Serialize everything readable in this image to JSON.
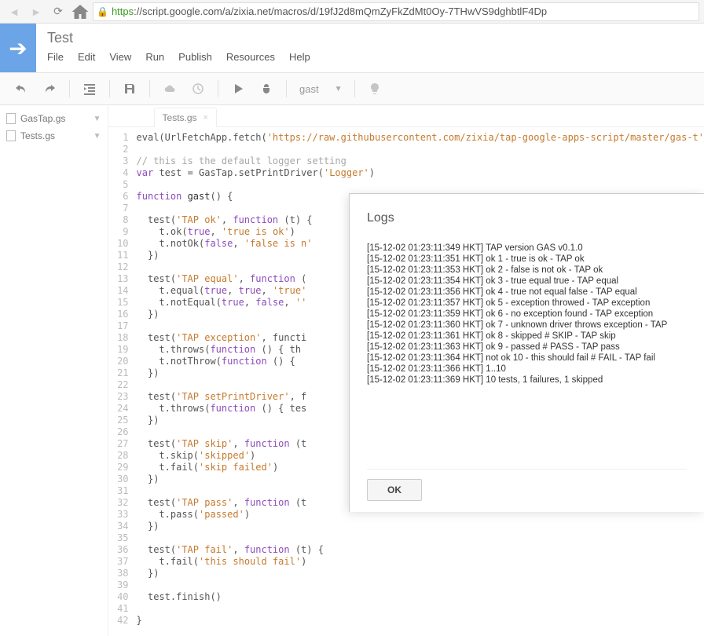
{
  "browser": {
    "url_https": "https",
    "url_rest": "://script.google.com/a/zixia.net/macros/d/19fJ2d8mQmZyFkZdMt0Oy-7THwVS9dghbtlF4Dp"
  },
  "app": {
    "title": "Test",
    "menus": [
      "File",
      "Edit",
      "View",
      "Run",
      "Publish",
      "Resources",
      "Help"
    ],
    "func_select": "gast"
  },
  "sidebar": {
    "files": [
      "GasTap.gs",
      "Tests.gs"
    ]
  },
  "tabs": {
    "active": "Tests.gs"
  },
  "code": {
    "lines": [
      {
        "n": 1,
        "html": "eval(UrlFetchApp.fetch(<span class='c-s'>'https://raw.githubusercontent.com/zixia/tap-google-apps-script/master/gas-t'</span>"
      },
      {
        "n": 2,
        "html": ""
      },
      {
        "n": 3,
        "html": "<span class='c-c'>// this is the default logger setting</span>"
      },
      {
        "n": 4,
        "html": "<span class='c-k'>var</span> test = GasTap.setPrintDriver(<span class='c-s'>'Logger'</span>)"
      },
      {
        "n": 5,
        "html": ""
      },
      {
        "n": 6,
        "html": "<span class='c-k'>function</span> <span class='c-f'>gast</span>() {"
      },
      {
        "n": 7,
        "html": ""
      },
      {
        "n": 8,
        "html": "  test(<span class='c-s'>'TAP ok'</span>, <span class='c-k'>function</span> (t) {"
      },
      {
        "n": 9,
        "html": "    t.ok(<span class='c-k'>true</span>, <span class='c-s'>'true is ok'</span>)"
      },
      {
        "n": 10,
        "html": "    t.notOk(<span class='c-k'>false</span>, <span class='c-s'>'false is n'</span>"
      },
      {
        "n": 11,
        "html": "  })"
      },
      {
        "n": 12,
        "html": ""
      },
      {
        "n": 13,
        "html": "  test(<span class='c-s'>'TAP equal'</span>, <span class='c-k'>function</span> ("
      },
      {
        "n": 14,
        "html": "    t.equal(<span class='c-k'>true</span>, <span class='c-k'>true</span>, <span class='c-s'>'true'</span>"
      },
      {
        "n": 15,
        "html": "    t.notEqual(<span class='c-k'>true</span>, <span class='c-k'>false</span>, <span class='c-s'>''</span>"
      },
      {
        "n": 16,
        "html": "  })"
      },
      {
        "n": 17,
        "html": ""
      },
      {
        "n": 18,
        "html": "  test(<span class='c-s'>'TAP exception'</span>, functi"
      },
      {
        "n": 19,
        "html": "    t.throws(<span class='c-k'>function</span> () { th"
      },
      {
        "n": 20,
        "html": "    t.notThrow(<span class='c-k'>function</span> () {"
      },
      {
        "n": 21,
        "html": "  })"
      },
      {
        "n": 22,
        "html": ""
      },
      {
        "n": 23,
        "html": "  test(<span class='c-s'>'TAP setPrintDriver'</span>, f"
      },
      {
        "n": 24,
        "html": "    t.throws(<span class='c-k'>function</span> () { tes"
      },
      {
        "n": 25,
        "html": "  })"
      },
      {
        "n": 26,
        "html": ""
      },
      {
        "n": 27,
        "html": "  test(<span class='c-s'>'TAP skip'</span>, <span class='c-k'>function</span> (t"
      },
      {
        "n": 28,
        "html": "    t.skip(<span class='c-s'>'skipped'</span>)"
      },
      {
        "n": 29,
        "html": "    t.fail(<span class='c-s'>'skip failed'</span>)"
      },
      {
        "n": 30,
        "html": "  })"
      },
      {
        "n": 31,
        "html": ""
      },
      {
        "n": 32,
        "html": "  test(<span class='c-s'>'TAP pass'</span>, <span class='c-k'>function</span> (t"
      },
      {
        "n": 33,
        "html": "    t.pass(<span class='c-s'>'passed'</span>)"
      },
      {
        "n": 34,
        "html": "  })"
      },
      {
        "n": 35,
        "html": ""
      },
      {
        "n": 36,
        "html": "  test(<span class='c-s'>'TAP fail'</span>, <span class='c-k'>function</span> (t) {"
      },
      {
        "n": 37,
        "html": "    t.fail(<span class='c-s'>'this should fail'</span>)"
      },
      {
        "n": 38,
        "html": "  })"
      },
      {
        "n": 39,
        "html": ""
      },
      {
        "n": 40,
        "html": "  test.finish()"
      },
      {
        "n": 41,
        "html": ""
      },
      {
        "n": 42,
        "html": "}"
      }
    ]
  },
  "dialog": {
    "title": "Logs",
    "ok": "OK",
    "lines": [
      "[15-12-02 01:23:11:349 HKT] TAP version GAS v0.1.0",
      "[15-12-02 01:23:11:351 HKT] ok 1 - true is ok - TAP ok",
      "[15-12-02 01:23:11:353 HKT] ok 2 - false is not ok - TAP ok",
      "[15-12-02 01:23:11:354 HKT] ok 3 - true equal true - TAP equal",
      "[15-12-02 01:23:11:356 HKT] ok 4 - true not equal false - TAP equal",
      "[15-12-02 01:23:11:357 HKT] ok 5 - exception throwed - TAP exception",
      "[15-12-02 01:23:11:359 HKT] ok 6 - no exception found - TAP exception",
      "[15-12-02 01:23:11:360 HKT] ok 7 - unknown driver throws exception - TAP",
      "[15-12-02 01:23:11:361 HKT] ok 8 - skipped # SKIP - TAP skip",
      "[15-12-02 01:23:11:363 HKT] ok 9 - passed # PASS - TAP pass",
      "[15-12-02 01:23:11:364 HKT] not ok 10 - this should fail # FAIL - TAP fail",
      "[15-12-02 01:23:11:366 HKT] 1..10",
      "[15-12-02 01:23:11:369 HKT] 10 tests, 1 failures, 1 skipped"
    ]
  }
}
